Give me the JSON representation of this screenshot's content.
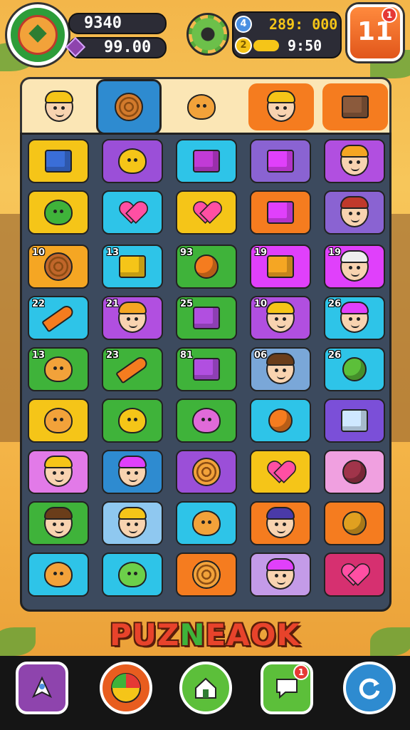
{
  "header": {
    "score": "9340",
    "gems": "99.00",
    "blue_coin": "4",
    "coins": "289: 000",
    "gold_coin": "2",
    "timer": "9:50",
    "level": "11",
    "level_badge": "1"
  },
  "tabs": [
    {
      "name": "characters",
      "active": false
    },
    {
      "name": "items",
      "active": true
    },
    {
      "name": "masks",
      "active": false
    },
    {
      "name": "heroes",
      "active": false
    },
    {
      "name": "blocks",
      "active": false
    }
  ],
  "board": {
    "rows": [
      [
        {
          "icon": "robot-icon",
          "n": ""
        },
        {
          "icon": "cat-face-icon",
          "n": ""
        },
        {
          "icon": "cube-icon",
          "n": ""
        },
        {
          "icon": "bed-icon",
          "n": ""
        },
        {
          "icon": "boy-face-icon",
          "n": ""
        }
      ],
      [
        {
          "icon": "fish-icon",
          "n": ""
        },
        {
          "icon": "heart-icon",
          "n": ""
        },
        {
          "icon": "heart-icon",
          "n": ""
        },
        {
          "icon": "cushion-icon",
          "n": ""
        },
        {
          "icon": "girl-face-icon",
          "n": ""
        }
      ],
      [
        {
          "icon": "target-icon",
          "n": "10"
        },
        {
          "icon": "gold-bar-icon",
          "n": "13"
        },
        {
          "icon": "ball-icon",
          "n": "93"
        },
        {
          "icon": "window-icon",
          "n": "19"
        },
        {
          "icon": "granny-face-icon",
          "n": "19"
        }
      ],
      [
        {
          "icon": "carrot-icon",
          "n": "22"
        },
        {
          "icon": "girl-face-icon",
          "n": "21"
        },
        {
          "icon": "box-icon",
          "n": "25"
        },
        {
          "icon": "girl-face-icon",
          "n": "10"
        },
        {
          "icon": "boy-face-icon",
          "n": "26"
        }
      ],
      [
        {
          "icon": "blob-icon",
          "n": "13"
        },
        {
          "icon": "carrot-icon",
          "n": "23"
        },
        {
          "icon": "box-icon",
          "n": "81"
        },
        {
          "icon": "girl-face-icon",
          "n": "06"
        },
        {
          "icon": "pepper-icon",
          "n": "26"
        }
      ],
      [
        {
          "icon": "blob-icon",
          "n": ""
        },
        {
          "icon": "cat-face-icon",
          "n": ""
        },
        {
          "icon": "pig-icon",
          "n": ""
        },
        {
          "icon": "ball-icon",
          "n": ""
        },
        {
          "icon": "eraser-icon",
          "n": ""
        }
      ],
      [
        {
          "icon": "girl-face-icon",
          "n": ""
        },
        {
          "icon": "girl-face-icon",
          "n": ""
        },
        {
          "icon": "swirl-icon",
          "n": ""
        },
        {
          "icon": "heart-icon",
          "n": ""
        },
        {
          "icon": "jar-icon",
          "n": ""
        }
      ],
      [
        {
          "icon": "boy-face-icon",
          "n": ""
        },
        {
          "icon": "boy-face-icon",
          "n": ""
        },
        {
          "icon": "blob-icon",
          "n": ""
        },
        {
          "icon": "girl-face-icon",
          "n": ""
        },
        {
          "icon": "badge-icon",
          "n": ""
        }
      ],
      [
        {
          "icon": "blob-icon",
          "n": ""
        },
        {
          "icon": "goblin-icon",
          "n": ""
        },
        {
          "icon": "swirl-icon",
          "n": ""
        },
        {
          "icon": "girl-face-icon",
          "n": ""
        },
        {
          "icon": "heart-icon",
          "n": ""
        }
      ]
    ]
  },
  "title": {
    "part1": "PUZ",
    "part2": "N",
    "part3": "EAOK"
  },
  "nav": {
    "messages_badge": "1",
    "buttons": [
      "rocket-icon",
      "spin-wheel-icon",
      "home-icon",
      "chat-icon",
      "refresh-icon"
    ]
  },
  "colors": {
    "board_bg": "#3c4a5e",
    "tab_active": "#2e8bd0",
    "accent": "#f57c1f"
  }
}
